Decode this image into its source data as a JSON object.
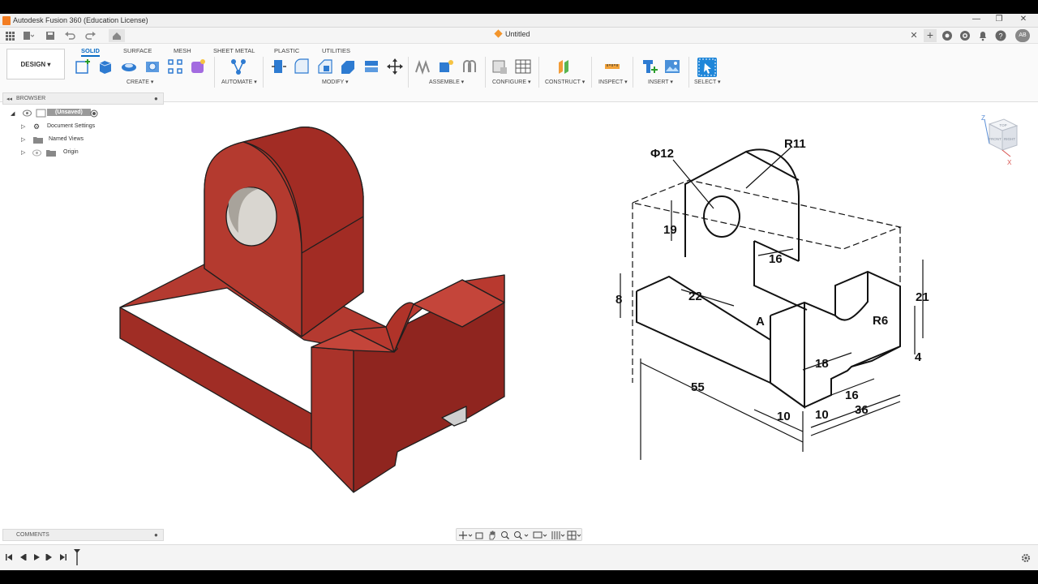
{
  "window": {
    "title": "Autodesk Fusion 360 (Education License)",
    "controls": [
      "—",
      "❐",
      "✕"
    ]
  },
  "document": {
    "tab_title": "Untitled",
    "close": "✕"
  },
  "user": {
    "initials": "AB"
  },
  "workspace": {
    "label": "DESIGN ▾"
  },
  "ribbon": {
    "tabs": [
      "SOLID",
      "SURFACE",
      "MESH",
      "SHEET METAL",
      "PLASTIC",
      "UTILITIES"
    ],
    "groups": [
      "CREATE ▾",
      "AUTOMATE ▾",
      "MODIFY ▾",
      "ASSEMBLE ▾",
      "CONFIGURE ▾",
      "CONSTRUCT ▾",
      "INSPECT ▾",
      "INSERT ▾",
      "SELECT ▾"
    ]
  },
  "browser": {
    "title": "BROWSER",
    "root": "(Unsaved)",
    "items": [
      "Document Settings",
      "Named Views",
      "Origin"
    ]
  },
  "comments": {
    "title": "COMMENTS"
  },
  "viewcube": {
    "top": "TOP",
    "front": "FRONT",
    "right": "RIGHT",
    "z": "Z",
    "x": "X"
  },
  "drawing": {
    "dims": {
      "phi12": "Φ12",
      "r11": "R11",
      "d19": "19",
      "d16a": "16",
      "d8": "8",
      "d22": "22",
      "a": "A",
      "d21": "21",
      "r6": "R6",
      "d4": "4",
      "d18": "18",
      "d55": "55",
      "d16b": "16",
      "d10a": "10",
      "d10b": "10",
      "d36": "36"
    }
  },
  "colors": {
    "model": "#a8302a",
    "accent": "#0a6cc5"
  }
}
